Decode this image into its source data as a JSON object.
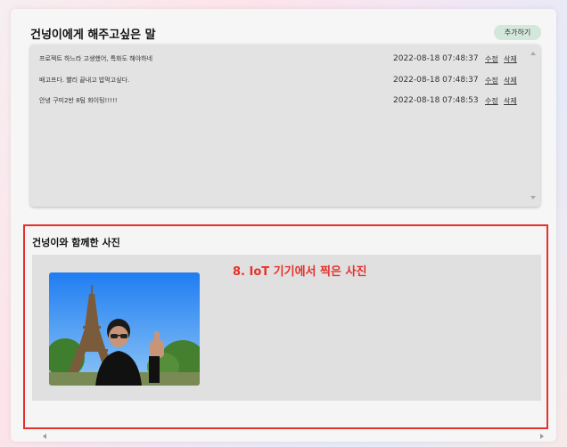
{
  "messages_section": {
    "title": "건넝이에게 해주고싶은 말",
    "add_button": "추가하기",
    "rows": [
      {
        "text": "프로젝트 하느라 고생했어, 특화도 해야하네",
        "date": "2022-08-18 07:48:37",
        "edit": "수정",
        "delete": "삭제"
      },
      {
        "text": "배고프다. 빨리 끝내고 밥먹고싶다.",
        "date": "2022-08-18 07:48:37",
        "edit": "수정",
        "delete": "삭제"
      },
      {
        "text": "안녕 구미2반 8팀 화이팅!!!!!",
        "date": "2022-08-18 07:48:53",
        "edit": "수정",
        "delete": "삭제"
      }
    ]
  },
  "photo_section": {
    "title": "건넝이와 함께한 사진",
    "annotation": "8. IoT 기기에서 찍은 사진"
  },
  "colors": {
    "highlight_red": "#e6312b",
    "add_button_bg": "#d3e7db",
    "panel_bg": "#e3e3e3"
  }
}
